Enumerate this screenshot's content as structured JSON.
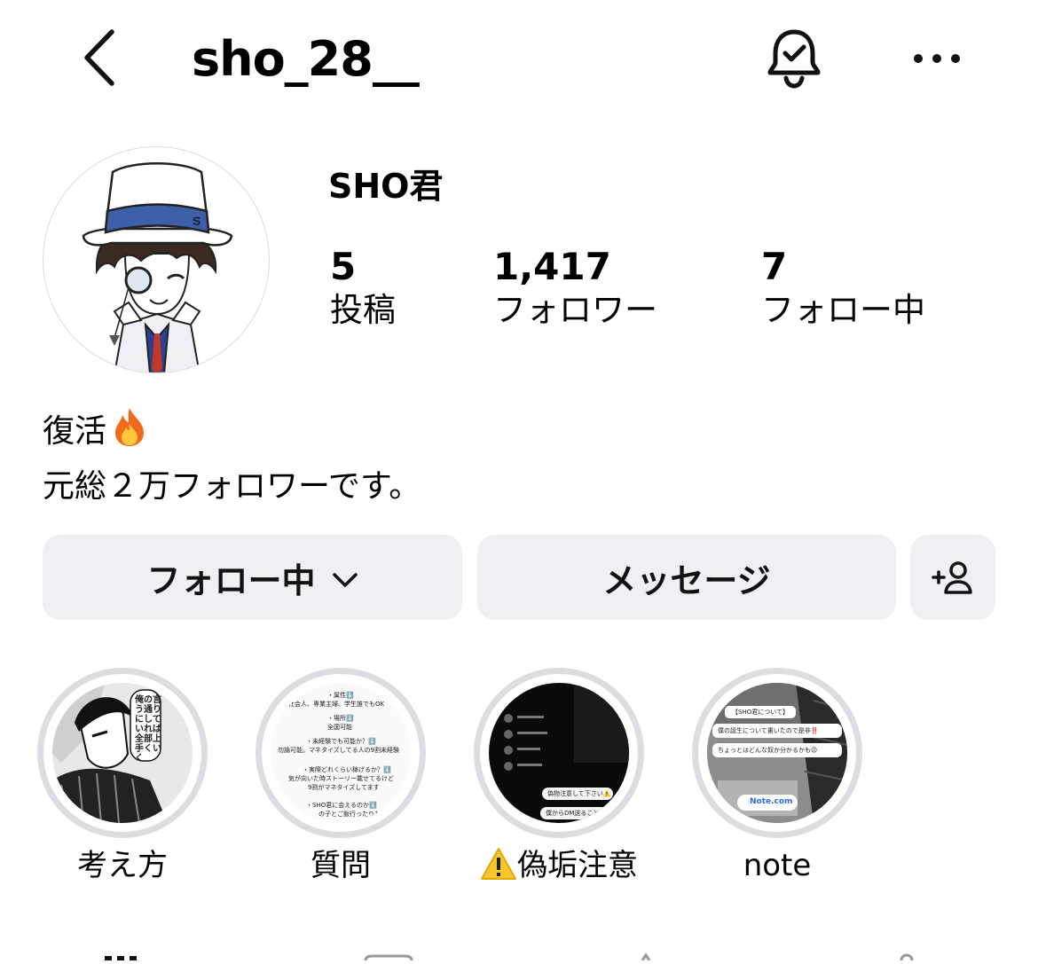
{
  "header": {
    "username": "sho_28__",
    "back_icon": "chevron-left-icon",
    "bell_icon": "bell-check-icon",
    "more_icon": "ellipsis-icon"
  },
  "profile": {
    "display_name": "SHO君",
    "stats": {
      "posts": {
        "count": "5",
        "label": "投稿"
      },
      "followers": {
        "count": "1,417",
        "label": "フォロワー"
      },
      "following": {
        "count": "7",
        "label": "フォロー中"
      }
    },
    "bio": {
      "line1": "復活",
      "line1_emoji": "fire-icon",
      "line2": "元総２万フォロワーです。"
    }
  },
  "actions": {
    "follow_label": "フォロー中",
    "message_label": "メッセージ",
    "add_user_icon": "add-user-icon"
  },
  "highlights": [
    {
      "label": "考え方",
      "cover_text": "俺の言う通りにしていれば全部上手くいく"
    },
    {
      "label": "質問",
      "cover_lines": [
        "・属性⬇️",
        "社会人、専業主婦、学生誰でもOK",
        "・場所⬇️",
        "全国可能",
        "・未経験でも可能か？⬇️",
        "勿論可能。マネタイズしてる人の9割未経験",
        "・実際どれくらい稼げるか？⬇️",
        "気が向いた時ストーリー載せてるけど",
        "9割がマネタイズしてます",
        "・SHO君に会えるのか⬇️",
        "の子とご飯行ったりもし"
      ]
    },
    {
      "label": "偽垢注意",
      "label_emoji": "warning-icon",
      "cover_lines": [
        "偽物注意して下さい⚠️",
        "僕からDM送ることありませ"
      ]
    },
    {
      "label": "note",
      "cover_lines": [
        "【SHO君について】",
        "僕の誕生について書いたので是非‼️",
        "ちょっとはどんな奴か分かるかも😉",
        "Note.com"
      ]
    }
  ],
  "colors": {
    "button_bg": "#efeff4",
    "highlight_ring": "#dcdde2",
    "text": "#000000"
  }
}
